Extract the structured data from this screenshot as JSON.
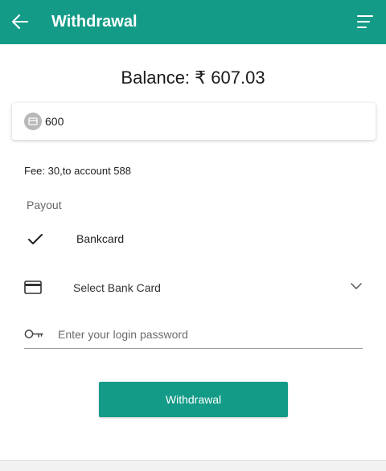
{
  "header": {
    "title": "Withdrawal",
    "color": "#149b88"
  },
  "balance": {
    "text": "Balance: ₹ 607.03"
  },
  "amount": {
    "value": "600"
  },
  "fee": {
    "text": "Fee: 30,to account 588"
  },
  "payout": {
    "label": "Payout",
    "option_label": "Bankcard",
    "selected": true
  },
  "bank_select": {
    "label": "Select Bank Card"
  },
  "password": {
    "placeholder": "Enter your login password"
  },
  "submit": {
    "label": "Withdrawal"
  },
  "icons": {
    "back": "arrow-left-icon",
    "menu": "menu-icon",
    "amount": "card-circle-icon",
    "check": "check-icon",
    "card": "credit-card-icon",
    "chevron": "chevron-down-icon",
    "key": "key-icon"
  }
}
